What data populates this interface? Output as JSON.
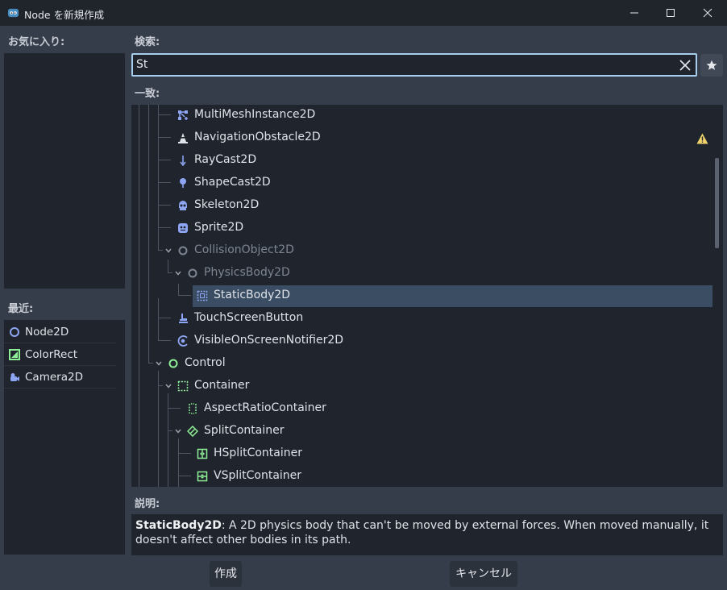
{
  "window": {
    "title": "Node を新規作成"
  },
  "favorites": {
    "label": "お気に入り:"
  },
  "recent": {
    "label": "最近:",
    "items": [
      {
        "label": "Node2D",
        "icon": "node2d-icon"
      },
      {
        "label": "ColorRect",
        "icon": "colorrect-icon"
      },
      {
        "label": "Camera2D",
        "icon": "camera2d-icon"
      }
    ]
  },
  "search": {
    "label": "検索:",
    "value": "St"
  },
  "matches": {
    "label": "一致:",
    "items": [
      {
        "label": "MultiMeshInstance2D"
      },
      {
        "label": "NavigationObstacle2D",
        "warning": true
      },
      {
        "label": "RayCast2D"
      },
      {
        "label": "ShapeCast2D"
      },
      {
        "label": "Skeleton2D"
      },
      {
        "label": "Sprite2D"
      },
      {
        "label": "CollisionObject2D",
        "dim": true
      },
      {
        "label": "PhysicsBody2D",
        "dim": true
      },
      {
        "label": "StaticBody2D",
        "selected": true
      },
      {
        "label": "TouchScreenButton"
      },
      {
        "label": "VisibleOnScreenNotifier2D"
      },
      {
        "label": "Control"
      },
      {
        "label": "Container"
      },
      {
        "label": "AspectRatioContainer"
      },
      {
        "label": "SplitContainer"
      },
      {
        "label": "HSplitContainer"
      },
      {
        "label": "VSplitContainer"
      }
    ]
  },
  "description": {
    "label": "説明:",
    "name": "StaticBody2D",
    "text": ": A 2D physics body that can't be moved by external forces. When moved manually, it doesn't affect other bodies in its path."
  },
  "buttons": {
    "create": "作成",
    "cancel": "キャンセル"
  },
  "colors": {
    "accent": "#a6cdec",
    "node2d": "#8da5f3",
    "control": "#8eef97",
    "selection": "#3a4d63"
  }
}
